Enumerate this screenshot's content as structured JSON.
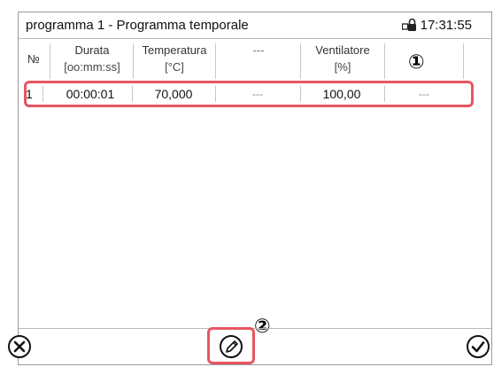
{
  "window": {
    "title": "programma 1 - Programma temporale",
    "time": "17:31:55",
    "lock_icon": "door-lock-icon"
  },
  "table": {
    "columns": [
      {
        "line1": "№",
        "line2": ""
      },
      {
        "line1": "Durata",
        "line2": "[oo:mm:ss]"
      },
      {
        "line1": "Temperatura",
        "line2": "[°C]"
      },
      {
        "line1": "---",
        "line2": ""
      },
      {
        "line1": "Ventilatore",
        "line2": "[%]"
      },
      {
        "line1": "",
        "line2": ""
      }
    ],
    "rows": [
      {
        "no": "1",
        "durata": "00:00:01",
        "temperatura": "70,000",
        "col4": "---",
        "ventilatore": "100,00",
        "col6": "---"
      }
    ]
  },
  "callouts": {
    "one": "①",
    "two": "②"
  },
  "toolbar": {
    "cancel_icon": "close-circle-icon",
    "edit_icon": "pencil-circle-icon",
    "confirm_icon": "checkmark-circle-icon"
  },
  "colors": {
    "highlight": "#e8565f",
    "border": "#9a9a9a"
  }
}
